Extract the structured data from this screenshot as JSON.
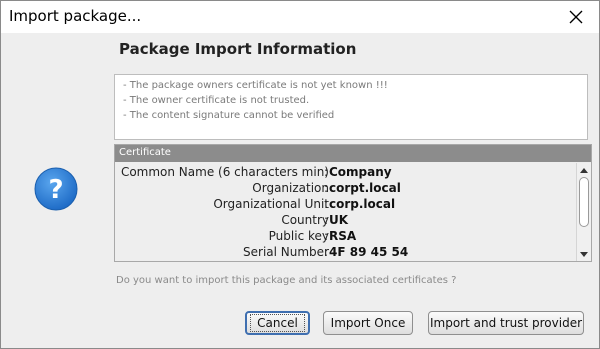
{
  "window": {
    "title": "Import package...",
    "close_icon": "close-icon"
  },
  "heading": "Package Import Information",
  "warnings": [
    "- The package owners certificate is not yet known !!!",
    "- The owner certificate is not trusted.",
    "- The content signature cannot be verified"
  ],
  "certificate": {
    "header": "Certificate",
    "separator": ":",
    "rows": [
      {
        "label": "Common Name (6 characters min)",
        "value": "Company"
      },
      {
        "label": "Organization",
        "value": "corpt.local"
      },
      {
        "label": "Organizational Unit",
        "value": "corp.local"
      },
      {
        "label": "Country",
        "value": "UK"
      },
      {
        "label": "Public key",
        "value": "RSA"
      },
      {
        "label": "Serial Number",
        "value": "4F 89 45 54"
      }
    ]
  },
  "help_icon": "question-mark-icon",
  "question": "Do you want to import this package and its associated certificates ?",
  "buttons": {
    "cancel": "Cancel",
    "import_once": "Import Once",
    "import_trust": "Import and trust provider"
  },
  "colors": {
    "help_icon": "#2f7fd6",
    "cert_header": "#8c8c8c",
    "default_button_border": "#3f6fb0"
  }
}
